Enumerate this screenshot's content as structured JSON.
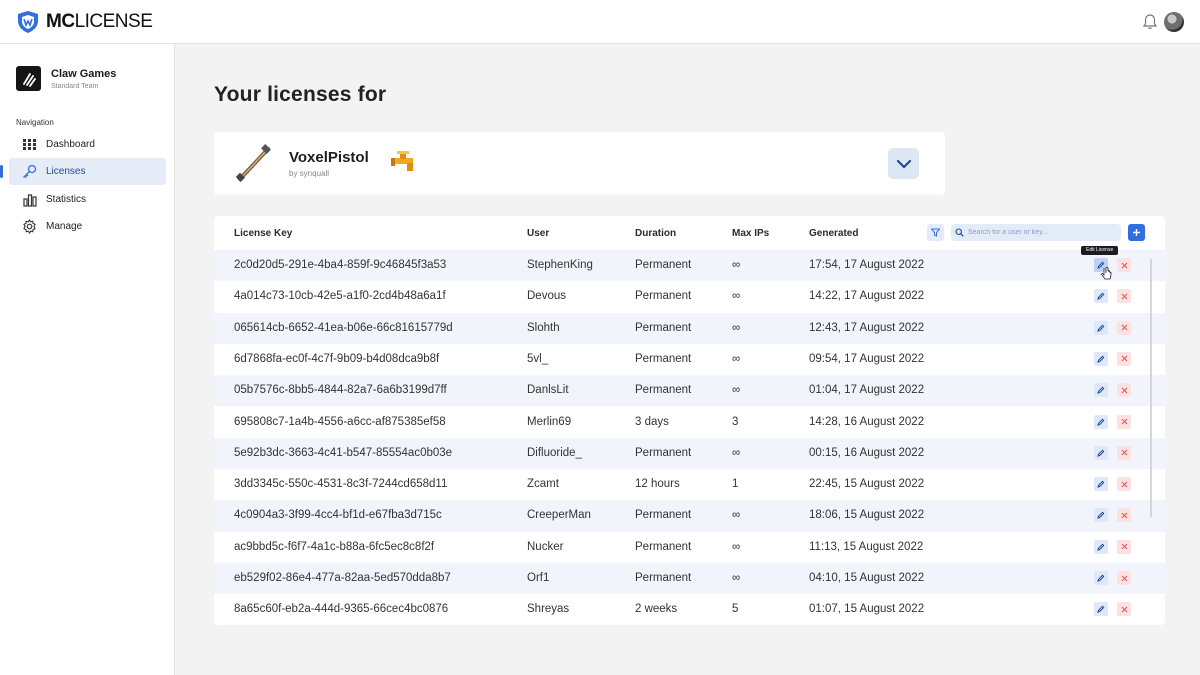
{
  "app": {
    "logo_bold": "MC",
    "logo_light": "LICENSE"
  },
  "header": {
    "bell_icon": "bell-icon",
    "avatar": "user-avatar"
  },
  "sidebar": {
    "team_name": "Claw Games",
    "team_plan": "Standard Team",
    "nav_heading": "Navigation",
    "items": [
      {
        "label": "Dashboard",
        "icon": "grid-icon",
        "active": false
      },
      {
        "label": "Licenses",
        "icon": "key-icon",
        "active": true
      },
      {
        "label": "Statistics",
        "icon": "bar-chart-icon",
        "active": false
      },
      {
        "label": "Manage",
        "icon": "gear-icon",
        "active": false
      }
    ]
  },
  "main": {
    "title": "Your licenses for",
    "product": {
      "name": "VoxelPistol",
      "author": "by synquall"
    },
    "table": {
      "headers": {
        "key": "License Key",
        "user": "User",
        "duration": "Duration",
        "max_ips": "Max IPs",
        "generated": "Generated"
      },
      "search_placeholder": "Search for a user or key...",
      "tooltip": "Edit License",
      "rows": [
        {
          "key": "2c0d20d5-291e-4ba4-859f-9c46845f3a53",
          "user": "StephenKing",
          "duration": "Permanent",
          "max_ips": "∞",
          "generated": "17:54, 17 August 2022"
        },
        {
          "key": "4a014c73-10cb-42e5-a1f0-2cd4b48a6a1f",
          "user": "Devous",
          "duration": "Permanent",
          "max_ips": "∞",
          "generated": "14:22, 17 August 2022"
        },
        {
          "key": "065614cb-6652-41ea-b06e-66c81615779d",
          "user": "Slohth",
          "duration": "Permanent",
          "max_ips": "∞",
          "generated": "12:43, 17 August 2022"
        },
        {
          "key": "6d7868fa-ec0f-4c7f-9b09-b4d08dca9b8f",
          "user": "5vl_",
          "duration": "Permanent",
          "max_ips": "∞",
          "generated": "09:54, 17 August 2022"
        },
        {
          "key": "05b7576c-8bb5-4844-82a7-6a6b3199d7ff",
          "user": "DanlsLit",
          "duration": "Permanent",
          "max_ips": "∞",
          "generated": "01:04, 17 August 2022"
        },
        {
          "key": "695808c7-1a4b-4556-a6cc-af875385ef58",
          "user": "Merlin69",
          "duration": "3 days",
          "max_ips": "3",
          "generated": "14:28, 16 August 2022"
        },
        {
          "key": "5e92b3dc-3663-4c41-b547-85554ac0b03e",
          "user": "Difluoride_",
          "duration": "Permanent",
          "max_ips": "∞",
          "generated": "00:15, 16 August 2022"
        },
        {
          "key": "3dd3345c-550c-4531-8c3f-7244cd658d11",
          "user": "Zcamt",
          "duration": "12 hours",
          "max_ips": "1",
          "generated": "22:45, 15 August 2022"
        },
        {
          "key": "4c0904a3-3f99-4cc4-bf1d-e67fba3d715c",
          "user": "CreeperMan",
          "duration": "Permanent",
          "max_ips": "∞",
          "generated": "18:06, 15 August 2022"
        },
        {
          "key": "ac9bbd5c-f6f7-4a1c-b88a-6fc5ec8c8f2f",
          "user": "Nucker",
          "duration": "Permanent",
          "max_ips": "∞",
          "generated": "11:13, 15 August 2022"
        },
        {
          "key": "eb529f02-86e4-477a-82aa-5ed570dda8b7",
          "user": "Orf1",
          "duration": "Permanent",
          "max_ips": "∞",
          "generated": "04:10, 15 August 2022"
        },
        {
          "key": "8a65c60f-eb2a-444d-9365-66cec4bc0876",
          "user": "Shreyas",
          "duration": "2 weeks",
          "max_ips": "5",
          "generated": "01:07, 15 August 2022"
        }
      ]
    }
  },
  "colors": {
    "accent": "#2f6fe0",
    "danger": "#e35b5b",
    "row_alt": "#f1f4fb"
  }
}
